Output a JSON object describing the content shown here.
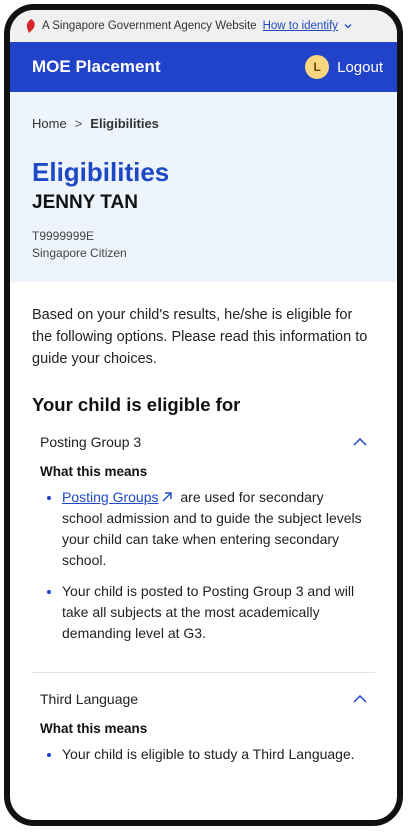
{
  "masthead": {
    "text": "A Singapore Government Agency Website",
    "link": "How to identify"
  },
  "appbar": {
    "title": "MOE Placement",
    "avatar_initial": "L",
    "logout_label": "Logout"
  },
  "breadcrumb": {
    "home": "Home",
    "separator": ">",
    "current": "Eligibilities"
  },
  "header": {
    "title": "Eligibilities",
    "name": "JENNY TAN",
    "id": "T9999999E",
    "citizenship": "Singapore Citizen"
  },
  "intro": "Based on your child's results, he/she is eligible for the following options. Please read this information to guide your choices.",
  "section_title": "Your child is eligible for",
  "accordions": [
    {
      "title": "Posting Group 3",
      "subhead": "What this means",
      "bullet1_link": "Posting Groups",
      "bullet1_rest": "are used for secondary school admission and to guide the subject levels your child can take when entering secondary school.",
      "bullet2": "Your child is posted to Posting Group 3 and will take all subjects at the most academically demanding level at G3."
    },
    {
      "title": "Third Language",
      "subhead": "What this means",
      "bullet1": "Your child is eligible to study a Third Language."
    }
  ],
  "colors": {
    "brand": "#2143c9",
    "title_blue": "#1e49c4",
    "hero_bg": "#eef4fb",
    "avatar": "#f9d77e"
  }
}
